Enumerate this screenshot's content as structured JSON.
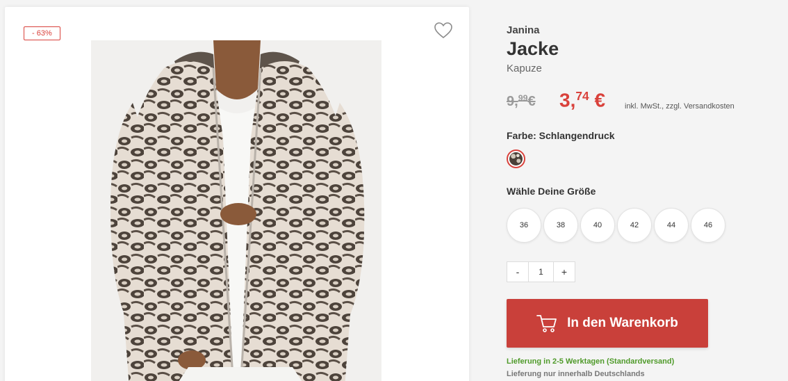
{
  "product": {
    "discount_badge": "- 63%",
    "brand": "Janina",
    "title": "Jacke",
    "subtitle": "Kapuze",
    "old_price_main": "9,",
    "old_price_cents": "99",
    "old_price_currency": "€",
    "new_price_main": "3,",
    "new_price_cents": "74",
    "new_price_currency": " €",
    "tax_note": "inkl. MwSt., zzgl. Versandkosten",
    "image_icon": "product-photo"
  },
  "color": {
    "label": "Farbe: Schlangendruck",
    "accent": "#d9413b"
  },
  "sizes": {
    "label": "Wähle Deine Größe",
    "options": [
      "36",
      "38",
      "40",
      "42",
      "44",
      "46"
    ]
  },
  "quantity": {
    "minus": "-",
    "value": "1",
    "plus": "+"
  },
  "cart": {
    "label": "In den Warenkorb",
    "icon": "cart-icon",
    "color": "#c9403a"
  },
  "delivery": {
    "time": "Lieferung in 2-5 Werktagen (Standardversand)",
    "region": "Lieferung nur innerhalb Deutschlands",
    "time_color": "#4f9a2a"
  },
  "wishlist_icon": "heart-icon"
}
